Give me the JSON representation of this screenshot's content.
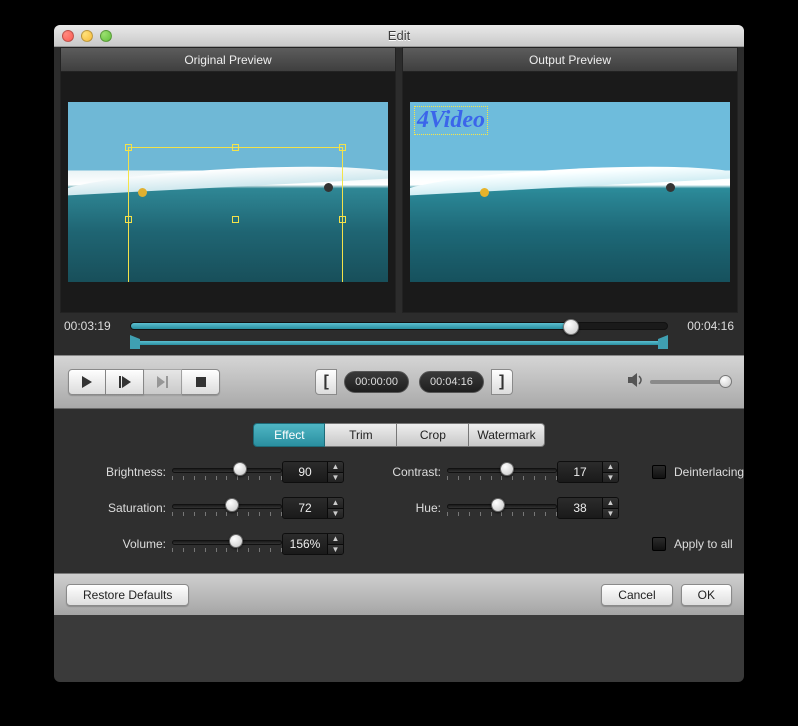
{
  "window": {
    "title": "Edit"
  },
  "preview": {
    "original_label": "Original Preview",
    "output_label": "Output Preview",
    "watermark_text": "4Video"
  },
  "timeline": {
    "current_time": "00:03:19",
    "total_time": "00:04:16",
    "progress_pct": 82
  },
  "controls": {
    "bracket_start": "[",
    "bracket_end": "]",
    "time_in": "00:00:00",
    "time_out": "00:04:16",
    "volume_pct": 100
  },
  "tabs": {
    "items": [
      "Effect",
      "Trim",
      "Crop",
      "Watermark"
    ],
    "active_index": 0
  },
  "effects": {
    "brightness": {
      "label": "Brightness:",
      "value": "90",
      "pct": 55
    },
    "contrast": {
      "label": "Contrast:",
      "value": "17",
      "pct": 48
    },
    "saturation": {
      "label": "Saturation:",
      "value": "72",
      "pct": 48
    },
    "hue": {
      "label": "Hue:",
      "value": "38",
      "pct": 40
    },
    "volume": {
      "label": "Volume:",
      "value": "156%",
      "pct": 52
    },
    "deinterlacing_label": "Deinterlacing",
    "deinterlacing_checked": false,
    "apply_all_label": "Apply to all",
    "apply_all_checked": false
  },
  "footer": {
    "restore": "Restore Defaults",
    "cancel": "Cancel",
    "ok": "OK"
  }
}
